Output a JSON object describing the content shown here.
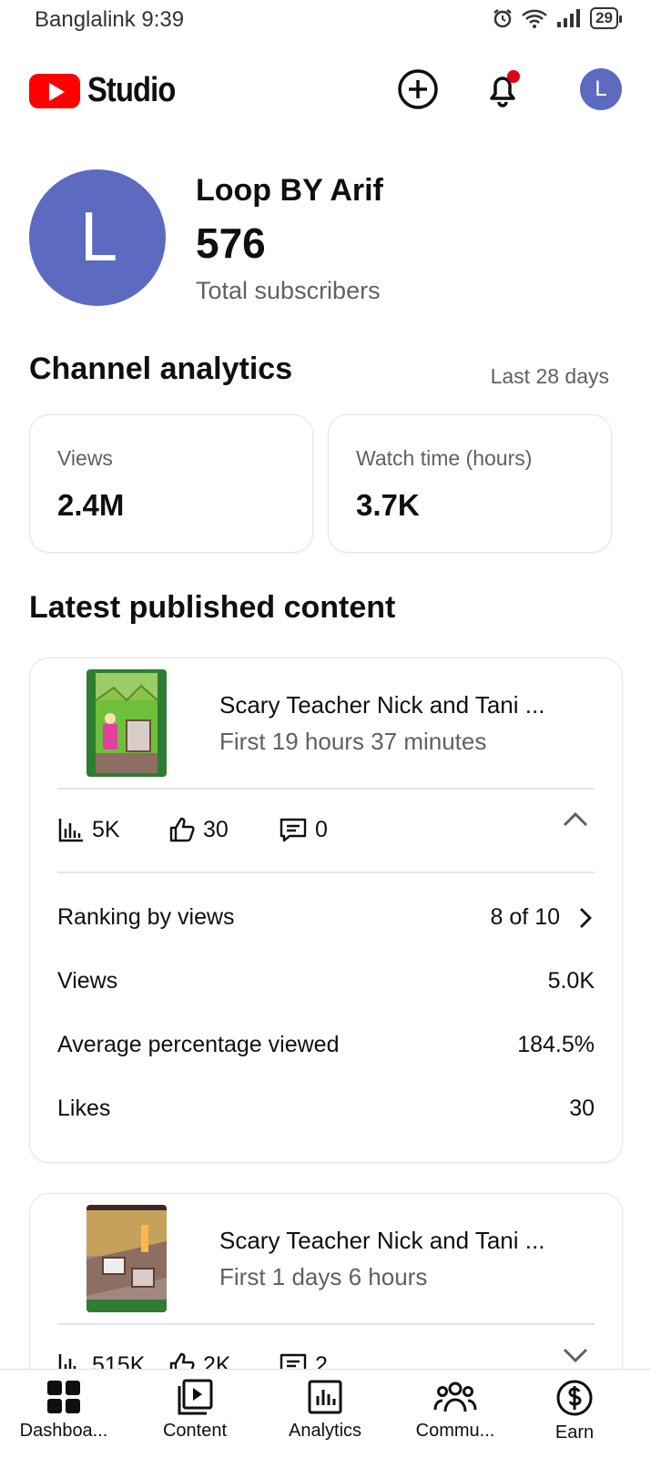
{
  "status_bar": {
    "carrier_time": "Banglalink 9:39",
    "battery": "29"
  },
  "header": {
    "brand": "Studio",
    "avatar_letter": "L"
  },
  "channel": {
    "avatar_letter": "L",
    "name": "Loop BY Arif",
    "subscribers": "576",
    "subscribers_label": "Total subscribers"
  },
  "analytics": {
    "title": "Channel analytics",
    "period": "Last 28 days",
    "metrics": [
      {
        "label": "Views",
        "value": "2.4M"
      },
      {
        "label": "Watch time (hours)",
        "value": "3.7K"
      }
    ]
  },
  "latest": {
    "title": "Latest published content",
    "items": [
      {
        "title": "Scary Teacher Nick and Tani ...",
        "subtitle": "First 19 hours 37 minutes",
        "views": "5K",
        "likes": "30",
        "comments": "0",
        "details": [
          {
            "label": "Ranking by views",
            "value": "8 of 10"
          },
          {
            "label": "Views",
            "value": "5.0K"
          },
          {
            "label": "Average percentage viewed",
            "value": "184.5%"
          },
          {
            "label": "Likes",
            "value": "30"
          }
        ]
      },
      {
        "title": "Scary Teacher Nick and Tani ...",
        "subtitle": "First 1 days 6 hours",
        "views": "515K",
        "likes": "2K",
        "comments": "2"
      }
    ]
  },
  "nav": [
    {
      "label": "Dashboa...",
      "icon": "dashboard-icon"
    },
    {
      "label": "Content",
      "icon": "content-icon"
    },
    {
      "label": "Analytics",
      "icon": "analytics-icon"
    },
    {
      "label": "Commu...",
      "icon": "community-icon"
    },
    {
      "label": "Earn",
      "icon": "earn-icon"
    }
  ],
  "colors": {
    "brand_red": "#ff0000",
    "avatar": "#5c6bc0",
    "secondary_text": "#606060",
    "notification_dot": "#e0001b"
  }
}
